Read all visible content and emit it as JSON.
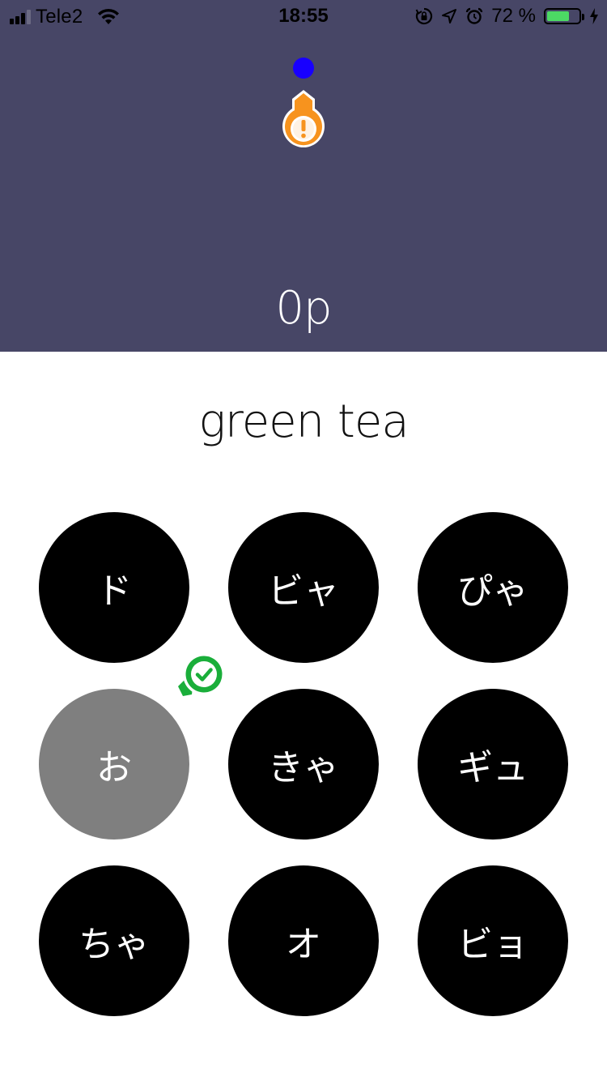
{
  "status_bar": {
    "carrier": "Tele2",
    "time": "18:55",
    "battery_text": "72 %",
    "battery_level": 0.72,
    "icons": [
      "signal-icon",
      "wifi-icon",
      "orientation-lock-icon",
      "location-arrow-icon",
      "alarm-icon",
      "battery-icon",
      "charging-bolt-icon"
    ]
  },
  "header": {
    "score": "0p",
    "marker_icons": [
      "blue-dot-icon",
      "warning-marker-icon"
    ]
  },
  "prompt": {
    "word": "green tea"
  },
  "choices": [
    {
      "label": "ド",
      "selected": false
    },
    {
      "label": "ビャ",
      "selected": false
    },
    {
      "label": "ぴゃ",
      "selected": false
    },
    {
      "label": "お",
      "selected": true
    },
    {
      "label": "きゃ",
      "selected": false
    },
    {
      "label": "ギュ",
      "selected": false
    },
    {
      "label": "ちゃ",
      "selected": false
    },
    {
      "label": "オ",
      "selected": false
    },
    {
      "label": "ビョ",
      "selected": false
    }
  ],
  "colors": {
    "header_bg": "#474666",
    "choice_bg": "#000000",
    "choice_selected_bg": "#7f7f7f",
    "marker_orange": "#f7931e",
    "marker_green": "#1aae3a",
    "dot_blue": "#1800ff"
  }
}
